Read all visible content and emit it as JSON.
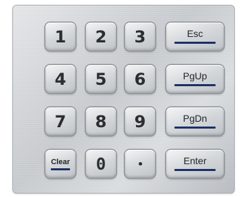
{
  "keypad": {
    "keys": {
      "k1": "1",
      "k2": "2",
      "k3": "3",
      "k4": "4",
      "k5": "5",
      "k6": "6",
      "k7": "7",
      "k8": "8",
      "k9": "9",
      "k0": "0",
      "esc": "Esc",
      "pgup": "PgUp",
      "pgdn": "PgDn",
      "enter": "Enter",
      "clear": "Clear"
    },
    "colors": {
      "label_bar": "#1b2f66",
      "steel": "#c9ccd0"
    }
  }
}
